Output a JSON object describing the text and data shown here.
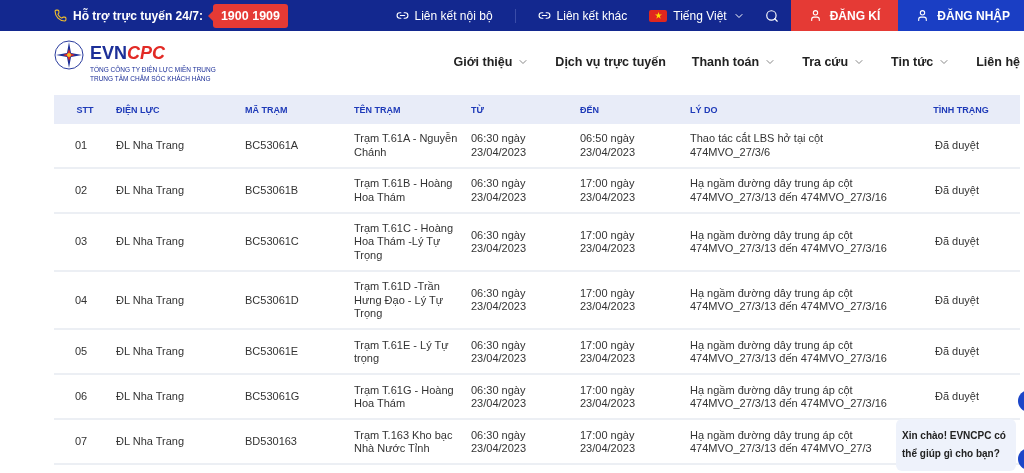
{
  "topbar": {
    "support_label": "Hỗ trợ trực tuyến 24/7:",
    "hotline": "1900 1909",
    "links": [
      {
        "label": "Liên kết nội bộ"
      },
      {
        "label": "Liên kết khác"
      }
    ],
    "language": "Tiếng Việt",
    "register": "ĐĂNG KÍ",
    "login": "ĐĂNG NHẬP"
  },
  "header": {
    "logo": {
      "primary": "EVN",
      "accent": "CPC"
    },
    "subtitle": [
      "TỔNG CÔNG TY ĐIỆN LỰC MIỀN TRUNG",
      "TRUNG TÂM CHĂM SÓC KHÁCH HÀNG"
    ],
    "nav": [
      {
        "label": "Giới thiệu",
        "has_dropdown": true
      },
      {
        "label": "Dịch vụ trực tuyến",
        "has_dropdown": false
      },
      {
        "label": "Thanh toán",
        "has_dropdown": true
      },
      {
        "label": "Tra cứu",
        "has_dropdown": true
      },
      {
        "label": "Tin tức",
        "has_dropdown": true
      },
      {
        "label": "Liên hệ",
        "has_dropdown": false
      }
    ]
  },
  "table": {
    "columns": [
      "STT",
      "ĐIỆN LỰC",
      "MÃ TRẠM",
      "TÊN TRẠM",
      "TỪ",
      "ĐẾN",
      "LÝ DO",
      "TÌNH TRẠNG"
    ],
    "rows": [
      {
        "stt": "01",
        "unit": "ĐL Nha Trang",
        "code": "BC53061A",
        "name": "Trạm T.61A - Nguyễn Chánh",
        "from": "06:30 ngày 23/04/2023",
        "to": "06:50 ngày 23/04/2023",
        "reason": "Thao tác cắt LBS hở tại cột 474MVO_27/3/6",
        "status": "Đã duyệt"
      },
      {
        "stt": "02",
        "unit": "ĐL Nha Trang",
        "code": "BC53061B",
        "name": "Trạm T.61B - Hoàng Hoa Thám",
        "from": "06:30 ngày 23/04/2023",
        "to": "17:00 ngày 23/04/2023",
        "reason": "Hạ ngầm đường dây trung áp cột 474MVO_27/3/13 đến 474MVO_27/3/16",
        "status": "Đã duyệt"
      },
      {
        "stt": "03",
        "unit": "ĐL Nha Trang",
        "code": "BC53061C",
        "name": "Trạm T.61C - Hoàng Hoa Thám -Lý Tự Trọng",
        "from": "06:30 ngày 23/04/2023",
        "to": "17:00 ngày 23/04/2023",
        "reason": "Hạ ngầm đường dây trung áp cột 474MVO_27/3/13 đến 474MVO_27/3/16",
        "status": "Đã duyệt"
      },
      {
        "stt": "04",
        "unit": "ĐL Nha Trang",
        "code": "BC53061D",
        "name": "Trạm T.61D -Trần Hưng Đạo - Lý Tự Trọng",
        "from": "06:30 ngày 23/04/2023",
        "to": "17:00 ngày 23/04/2023",
        "reason": "Hạ ngầm đường dây trung áp cột 474MVO_27/3/13 đến 474MVO_27/3/16",
        "status": "Đã duyệt"
      },
      {
        "stt": "05",
        "unit": "ĐL Nha Trang",
        "code": "BC53061E",
        "name": "Trạm T.61E - Lý Tự trọng",
        "from": "06:30 ngày 23/04/2023",
        "to": "17:00 ngày 23/04/2023",
        "reason": "Hạ ngầm đường dây trung áp cột 474MVO_27/3/13 đến 474MVO_27/3/16",
        "status": "Đã duyệt"
      },
      {
        "stt": "06",
        "unit": "ĐL Nha Trang",
        "code": "BC53061G",
        "name": "Trạm T.61G - Hoàng Hoa Thám",
        "from": "06:30 ngày 23/04/2023",
        "to": "17:00 ngày 23/04/2023",
        "reason": "Hạ ngầm đường dây trung áp cột 474MVO_27/3/13 đến 474MVO_27/3/16",
        "status": "Đã duyệt"
      },
      {
        "stt": "07",
        "unit": "ĐL Nha Trang",
        "code": "BD530163",
        "name": "Trạm T.163 Kho bạc Nhà Nước Tỉnh",
        "from": "06:30 ngày 23/04/2023",
        "to": "17:00 ngày 23/04/2023",
        "reason": "Hạ ngầm đường dây trung áp cột 474MVO_27/3/13 đến 474MVO_27/3"
      }
    ]
  },
  "chat": {
    "message": "Xin chào! EVNCPC có thể giúp gì cho bạn?"
  }
}
